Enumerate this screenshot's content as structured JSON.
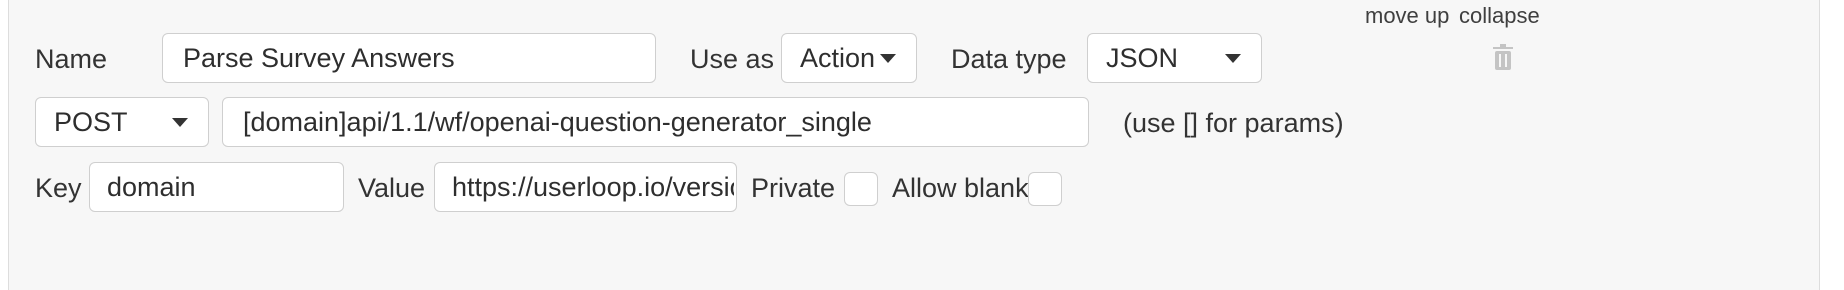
{
  "header": {
    "move_up": "move up",
    "collapse": "collapse"
  },
  "row1": {
    "name_label": "Name",
    "name_value": "Parse Survey Answers",
    "use_as_label": "Use as",
    "use_as_value": "Action",
    "data_type_label": "Data type",
    "data_type_value": "JSON",
    "delete_icon": "trash-icon"
  },
  "row2": {
    "method_value": "POST",
    "url_value": "[domain]api/1.1/wf/openai-question-generator_single",
    "hint": "(use [] for params)"
  },
  "row3": {
    "key_label": "Key",
    "key_value": "domain",
    "value_label": "Value",
    "value_value": "https://userloop.io/version-test/",
    "private_label": "Private",
    "allow_blank_label": "Allow blank"
  }
}
